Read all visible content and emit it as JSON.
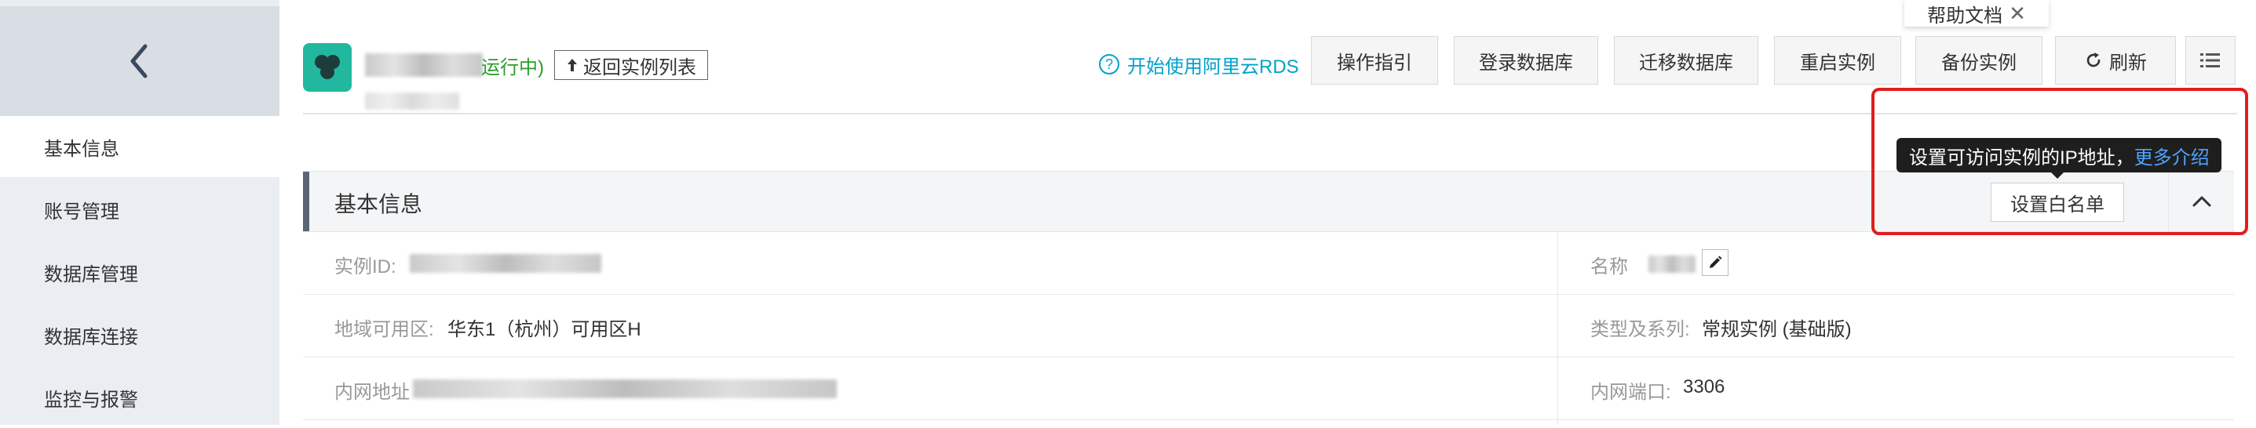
{
  "sidebar": {
    "back_icon": "chevron-left-icon",
    "items": [
      {
        "label": "基本信息",
        "active": true
      },
      {
        "label": "账号管理",
        "active": false
      },
      {
        "label": "数据库管理",
        "active": false
      },
      {
        "label": "数据库连接",
        "active": false
      },
      {
        "label": "监控与报警",
        "active": false
      }
    ]
  },
  "header": {
    "instance_status": "运行中)",
    "back_to_list": "返回实例列表",
    "start_link": "开始使用阿里云RDS",
    "buttons": {
      "guide": "操作指引",
      "login_db": "登录数据库",
      "migrate_db": "迁移数据库",
      "restart": "重启实例",
      "backup": "备份实例",
      "refresh": "刷新"
    }
  },
  "help_doc": {
    "label": "帮助文档"
  },
  "section": {
    "title": "基本信息",
    "whitelist_button": "设置白名单",
    "tooltip_text": "设置可访问实例的IP地址，",
    "tooltip_link": "更多介绍"
  },
  "info": {
    "instance_id_label": "实例ID:",
    "name_label": "名称",
    "region_label": "地域可用区:",
    "region_value": "华东1（杭州）可用区H",
    "type_label": "类型及系列:",
    "type_value": "常规实例 (基础版)",
    "intranet_label": "内网地址",
    "port_label": "内网端口:",
    "port_value": "3306"
  },
  "colors": {
    "accent": "#ff6a00",
    "logo": "#22b8a0",
    "link": "#00a2ca",
    "status_running": "#2a9d2a",
    "highlight_box": "#e01e1e"
  }
}
